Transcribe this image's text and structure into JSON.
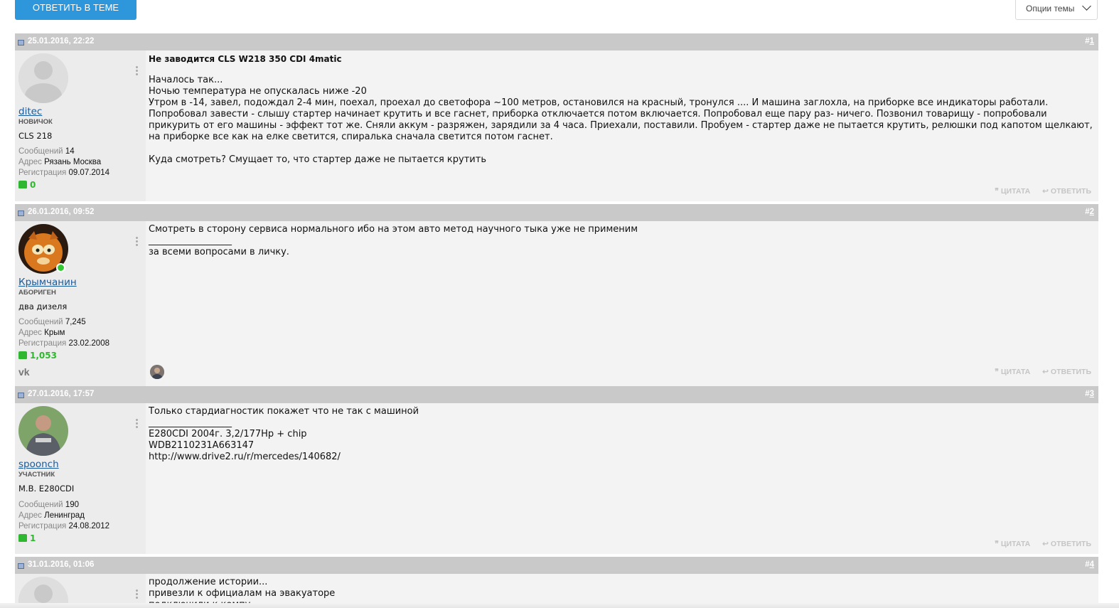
{
  "toolbar": {
    "reply_label": "ОТВЕТИТЬ В ТЕМЕ",
    "options_label": "Опции темы"
  },
  "actions": {
    "quote": "ЦИТАТА",
    "reply": "ОТВЕТИТЬ"
  },
  "stat_labels": {
    "messages": "Сообщений",
    "address": "Адрес",
    "registration": "Регистрация"
  },
  "posts": [
    {
      "date": "25.01.2016, 22:22",
      "number_prefix": "#",
      "number": "1",
      "user": {
        "name": "ditec",
        "rank": "НОВИЧОК",
        "car": "CLS 218",
        "messages": "14",
        "address": "Рязань Москва",
        "registration": "09.07.2014",
        "likes": "0"
      },
      "title": "Не заводится CLS W218 350 CDI 4matic",
      "text": "Началось так...\nНочью температура не опускалась ниже -20\nУтром в -14, завел, подождал 2-4 мин, поехал, проехал до светофора ~100 метров, остановился на красный, тронулся .... И машина заглохла, на приборке все индикаторы работали.\nПопробовал завести - слышу стартер начинает крутить и все гаснет, приборка отключается потом включается. Попробовал еще пару раз- ничего. Позвонил товарищу - попробовали прикурить от его машины - эффект тот же. Сняли аккум - разряжен, зарядили за 4 часа. Приехали, поставили. Пробуем - стартер даже не пытается крутить, релюшки под капотом щелкают, на приборке все как на елке светится, спиралька сначала светится потом гаснет.\n\nКуда смотреть? Смущает то, что стартер даже не пытается крутить"
    },
    {
      "date": "26.01.2016, 09:52",
      "number_prefix": "#",
      "number": "2",
      "user": {
        "name": "Крымчанин",
        "rank": "АБОРИГЕН",
        "car": "два дизеля",
        "messages": "7,245",
        "address": "Крым",
        "registration": "23.02.2008",
        "likes": "1,053"
      },
      "text": "Смотреть в сторону сервиса нормального ибо на этом авто метод научного тыка уже не применим\n__________________\nза всеми вопросами в личку."
    },
    {
      "date": "27.01.2016, 17:57",
      "number_prefix": "#",
      "number": "3",
      "user": {
        "name": "spoonch",
        "rank": "УЧАСТНИК",
        "car": "M.B. E280CDI",
        "messages": "190",
        "address": "Ленинград",
        "registration": "24.08.2012",
        "likes": "1"
      },
      "text": "Только стардиагностик покажет что не так с машиной\n__________________\nE280CDI 2004г. 3,2/177Hp + chip\nWDB2110231A663147\nhttp://www.drive2.ru/r/mercedes/140682/"
    },
    {
      "date": "31.01.2016, 01:06",
      "number_prefix": "#",
      "number": "4",
      "text": "продолжение истории...\nпривезли к официалам на эвакуаторе\nподключили к компу"
    }
  ],
  "colors": {
    "accent": "#2e96db",
    "header_bar": "#c9c9c9",
    "likes": "#2fb82f",
    "link": "#1a5a9a"
  },
  "icons": [
    "thumbs-up-icon",
    "quote-icon",
    "reply-arrow-icon",
    "vk-icon",
    "options-chevron-icon",
    "post-status-icon"
  ]
}
